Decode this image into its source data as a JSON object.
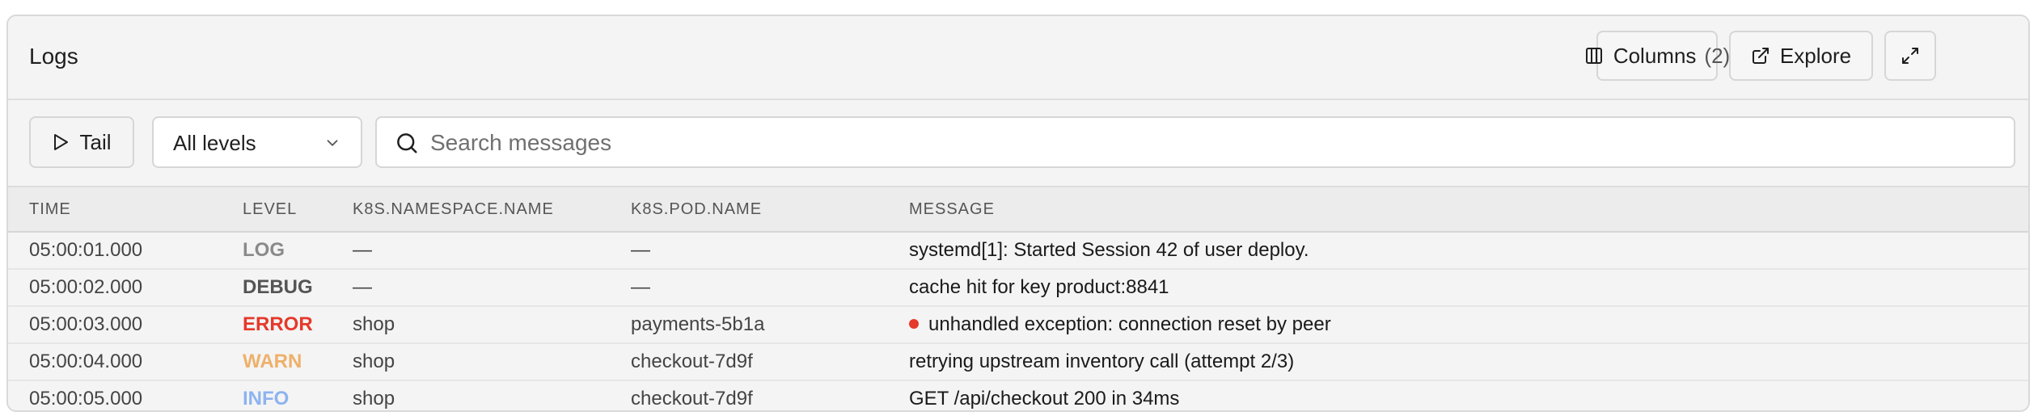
{
  "panel": {
    "title": "Logs",
    "columns_button": {
      "label": "Columns",
      "count": "(2)",
      "icon": "columns-icon"
    },
    "explore_button": {
      "label": "Explore",
      "icon": "external-link-icon"
    },
    "expand_button": {
      "icon": "expand-icon"
    }
  },
  "toolbar": {
    "tail_label": "Tail",
    "level_select": {
      "value": "All levels",
      "icon": "chevron-down-icon"
    },
    "search": {
      "placeholder": "Search messages",
      "value": "",
      "icon": "search-icon"
    }
  },
  "table": {
    "headers": [
      "TIME",
      "LEVEL",
      "K8S.NAMESPACE.NAME",
      "K8S.POD.NAME",
      "MESSAGE"
    ],
    "rows": [
      {
        "time": "05:00:01.000",
        "level": "LOG",
        "namespace": "—",
        "pod": "—",
        "message": "systemd[1]: Started Session 42 of user deploy.",
        "error_dot": false
      },
      {
        "time": "05:00:02.000",
        "level": "DEBUG",
        "namespace": "—",
        "pod": "—",
        "message": "cache hit for key product:8841",
        "error_dot": false
      },
      {
        "time": "05:00:03.000",
        "level": "ERROR",
        "namespace": "shop",
        "pod": "payments-5b1a",
        "message": "unhandled exception: connection reset by peer",
        "error_dot": true
      },
      {
        "time": "05:00:04.000",
        "level": "WARN",
        "namespace": "shop",
        "pod": "checkout-7d9f",
        "message": "retrying upstream inventory call (attempt 2/3)",
        "error_dot": false
      },
      {
        "time": "05:00:05.000",
        "level": "INFO",
        "namespace": "shop",
        "pod": "checkout-7d9f",
        "message": "GET /api/checkout 200 in 34ms",
        "error_dot": false
      }
    ]
  },
  "level_colors": {
    "LOG": "#8a8a8a",
    "DEBUG": "#555555",
    "ERROR": "#e5392b",
    "WARN": "#eeb06a",
    "INFO": "#8db3f0"
  }
}
